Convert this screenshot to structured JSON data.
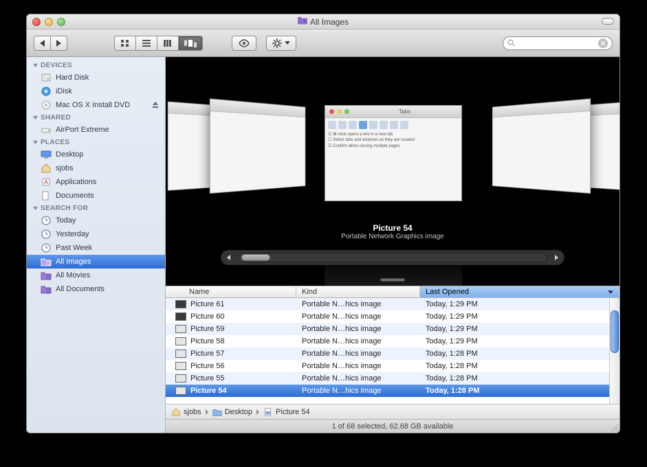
{
  "window": {
    "title": "All Images"
  },
  "sidebar": {
    "sections": [
      {
        "header": "DEVICES",
        "items": [
          {
            "icon": "hdd-icon",
            "label": "Hard Disk"
          },
          {
            "icon": "idisk-icon",
            "label": "iDisk"
          },
          {
            "icon": "disc-icon",
            "label": "Mac OS X Install DVD",
            "eject": true
          }
        ]
      },
      {
        "header": "SHARED",
        "items": [
          {
            "icon": "router-icon",
            "label": "AirPort Extreme"
          }
        ]
      },
      {
        "header": "PLACES",
        "items": [
          {
            "icon": "desktop-icon",
            "label": "Desktop"
          },
          {
            "icon": "home-icon",
            "label": "sjobs"
          },
          {
            "icon": "apps-icon",
            "label": "Applications"
          },
          {
            "icon": "docs-icon",
            "label": "Documents"
          }
        ]
      },
      {
        "header": "SEARCH FOR",
        "items": [
          {
            "icon": "clock-icon",
            "label": "Today"
          },
          {
            "icon": "clock-icon",
            "label": "Yesterday"
          },
          {
            "icon": "clock-icon",
            "label": "Past Week"
          },
          {
            "icon": "smart-folder-icon",
            "label": "All Images",
            "selected": true
          },
          {
            "icon": "smart-folder-icon",
            "label": "All Movies"
          },
          {
            "icon": "smart-folder-icon",
            "label": "All Documents"
          }
        ]
      }
    ]
  },
  "coverflow": {
    "title": "Picture 54",
    "subtitle": "Portable Network Graphics image"
  },
  "list": {
    "columns": {
      "name": "Name",
      "kind": "Kind",
      "opened": "Last Opened"
    },
    "sort_column": "opened",
    "rows": [
      {
        "name": "Picture 61",
        "kind": "Portable N…hics image",
        "opened": "Today, 1:29 PM",
        "thumb": "dark"
      },
      {
        "name": "Picture 60",
        "kind": "Portable N…hics image",
        "opened": "Today, 1:29 PM",
        "thumb": "dark"
      },
      {
        "name": "Picture 59",
        "kind": "Portable N…hics image",
        "opened": "Today, 1:29 PM",
        "thumb": "light"
      },
      {
        "name": "Picture 58",
        "kind": "Portable N…hics image",
        "opened": "Today, 1:29 PM",
        "thumb": "light"
      },
      {
        "name": "Picture 57",
        "kind": "Portable N…hics image",
        "opened": "Today, 1:28 PM",
        "thumb": "light"
      },
      {
        "name": "Picture 56",
        "kind": "Portable N…hics image",
        "opened": "Today, 1:28 PM",
        "thumb": "light"
      },
      {
        "name": "Picture 55",
        "kind": "Portable N…hics image",
        "opened": "Today, 1:28 PM",
        "thumb": "light"
      },
      {
        "name": "Picture 54",
        "kind": "Portable N…hics image",
        "opened": "Today, 1:28 PM",
        "thumb": "light",
        "selected": true
      }
    ]
  },
  "path": [
    {
      "icon": "home-icon",
      "label": "sjobs"
    },
    {
      "icon": "folder-icon",
      "label": "Desktop"
    },
    {
      "icon": "image-file-icon",
      "label": "Picture 54"
    }
  ],
  "status": "1 of 68 selected, 62.68 GB available"
}
